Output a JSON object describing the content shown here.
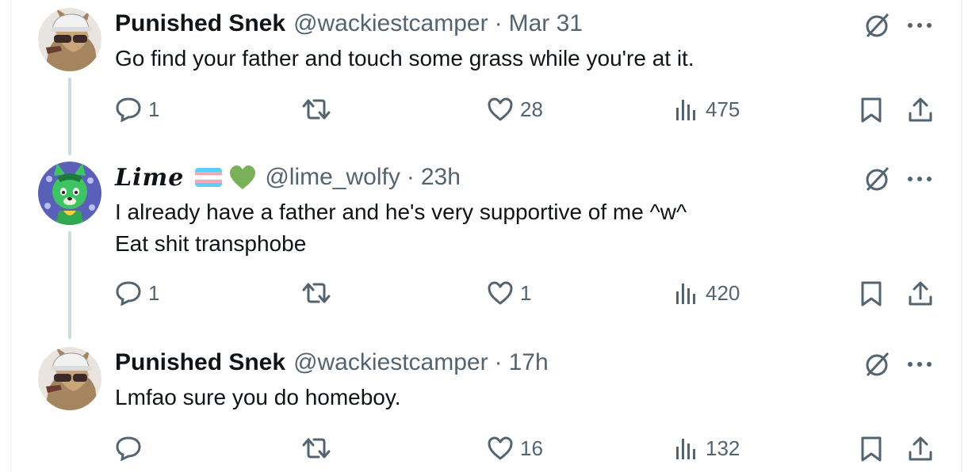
{
  "tweets": [
    {
      "display_name": "Punished Snek",
      "handle": "@wackiestcamper",
      "separator": "·",
      "time": "Mar 31",
      "lines": [
        "Go find your father and touch some grass while you're at it."
      ],
      "avatar": "wolf-cap-avatar",
      "counts": {
        "replies": "1",
        "retweets": "",
        "likes": "28",
        "views": "475"
      }
    },
    {
      "display_name": "Lime",
      "handle": "@lime_wolfy",
      "separator": "·",
      "time": "23h",
      "lines": [
        "I already have a father and he's very supportive of me ^w^",
        "Eat shit transphobe"
      ],
      "avatar": "green-wolf-avatar",
      "emoji": [
        "trans-flag",
        "green-heart"
      ],
      "counts": {
        "replies": "1",
        "retweets": "",
        "likes": "1",
        "views": "420"
      }
    },
    {
      "display_name": "Punished Snek",
      "handle": "@wackiestcamper",
      "separator": "·",
      "time": "17h",
      "lines": [
        "Lmfao sure you do homeboy."
      ],
      "avatar": "wolf-cap-avatar",
      "counts": {
        "replies": "",
        "retweets": "",
        "likes": "16",
        "views": "132"
      }
    }
  ],
  "icons": {
    "reply": "reply-icon",
    "retweet": "retweet-icon",
    "like": "heart-icon",
    "views": "views-icon",
    "bookmark": "bookmark-icon",
    "share": "share-icon",
    "grok": "grok-icon",
    "more": "more-icon"
  },
  "colors": {
    "text": "#0f1419",
    "secondary": "#536471",
    "thread": "#cfd9de",
    "trans_blue": "#5bcefa",
    "trans_pink": "#f5a9b8",
    "heart_green": "#78b159"
  }
}
